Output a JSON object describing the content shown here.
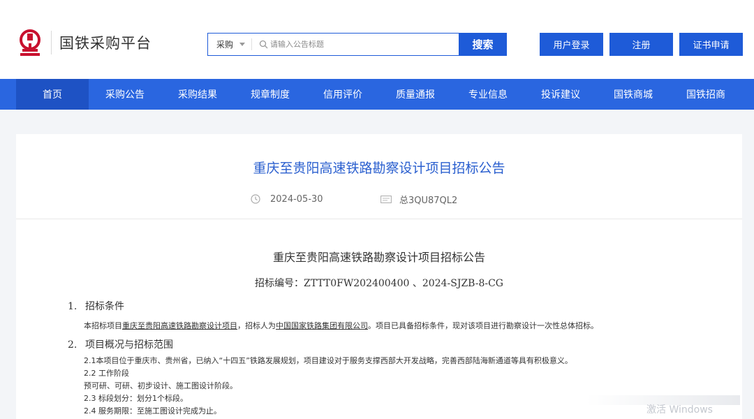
{
  "header": {
    "site_name": "国铁采购平台",
    "search": {
      "category": "采购",
      "placeholder": "请输入公告标题",
      "button": "搜索"
    },
    "buttons": {
      "login": "用户登录",
      "register": "注册",
      "cert": "证书申请"
    }
  },
  "nav": {
    "items": [
      {
        "label": "首页"
      },
      {
        "label": "采购公告"
      },
      {
        "label": "采购结果"
      },
      {
        "label": "规章制度"
      },
      {
        "label": "信用评价"
      },
      {
        "label": "质量通报"
      },
      {
        "label": "专业信息"
      },
      {
        "label": "投诉建议"
      },
      {
        "label": "国铁商城"
      },
      {
        "label": "国铁招商"
      }
    ],
    "active": "首页"
  },
  "notice": {
    "title": "重庆至贵阳高速铁路勘察设计项目招标公告",
    "date": "2024-05-30",
    "id": "总3QU87QL2"
  },
  "document": {
    "title": "重庆至贵阳高速铁路勘察设计项目招标公告",
    "code": "招标编号：ZTTT0FW202400400 、2024-SJZB-8-CG",
    "sections": [
      {
        "num": "1.",
        "heading": "招标条件",
        "p1_a": "本招标项目",
        "p1_link1": "重庆至贵阳高速铁路勘察设计项目",
        "p1_b": "，招标人为",
        "p1_link2": "中国国家铁路集团有限公司",
        "p1_c": "。项目已具备招标条件，现对该项目进行勘察设计一次性总体招标。"
      },
      {
        "num": "2.",
        "heading": "项目概况与招标范围",
        "lines": [
          "2.1本项目位于重庆市、贵州省，已纳入“十四五”铁路发展规划，项目建设对于服务支撑西部大开发战略，完善西部陆海新通道等具有积极意义。",
          "2.2 工作阶段",
          "预可研、可研、初步设计、施工图设计阶段。",
          "2.3 标段划分：划分1个标段。",
          "2.4 服务期限：至施工图设计完成为止。"
        ]
      }
    ]
  },
  "watermark": "激活 Windows",
  "colors": {
    "primary": "#1e5bd8",
    "nav": "#2a66e0",
    "nav_active": "#1e52c4",
    "title": "#2a5fcf",
    "logo_red": "#c8102e"
  }
}
